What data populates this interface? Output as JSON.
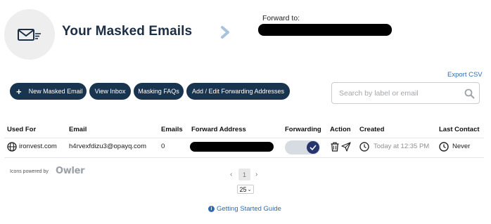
{
  "header": {
    "title": "Your Masked Emails",
    "forward_to_label": "Forward to:"
  },
  "toolbar": {
    "new_label": "New Masked Email",
    "inbox_label": "View Inbox",
    "faq_label": "Masking FAQs",
    "forwarding_label": "Add / Edit Forwarding Addresses",
    "export_label": "Export CSV"
  },
  "search": {
    "placeholder": "Search by label or email",
    "value": ""
  },
  "table": {
    "headers": {
      "used_for": "Used For",
      "email": "Email",
      "emails": "Emails",
      "forward_address": "Forward Address",
      "forwarding": "Forwarding",
      "action": "Action",
      "created": "Created",
      "last_contact": "Last Contact"
    },
    "rows": [
      {
        "used_for": "ironvest.com",
        "email": "h4rvexfdizu3@opayq.com",
        "emails": "0",
        "forwarding_on": true,
        "created": "Today at 12:35 PM",
        "last_contact": "Never"
      }
    ]
  },
  "footer": {
    "powered_by": "Icons powered by",
    "powered_brand": "Owler",
    "pager_prev": "‹",
    "pager_next": "›",
    "current_page": "1",
    "per_page": "25",
    "guide_label": "Getting Started Guide"
  },
  "colors": {
    "primary": "#18344f",
    "link": "#2f6bb0",
    "toggle_knob": "#26366d"
  },
  "icons": {
    "hero": "email-forward-icon",
    "search": "search-icon",
    "globe": "globe-icon",
    "trash": "trash-icon",
    "send": "send-icon",
    "clock": "clock-icon",
    "info": "info-icon"
  }
}
